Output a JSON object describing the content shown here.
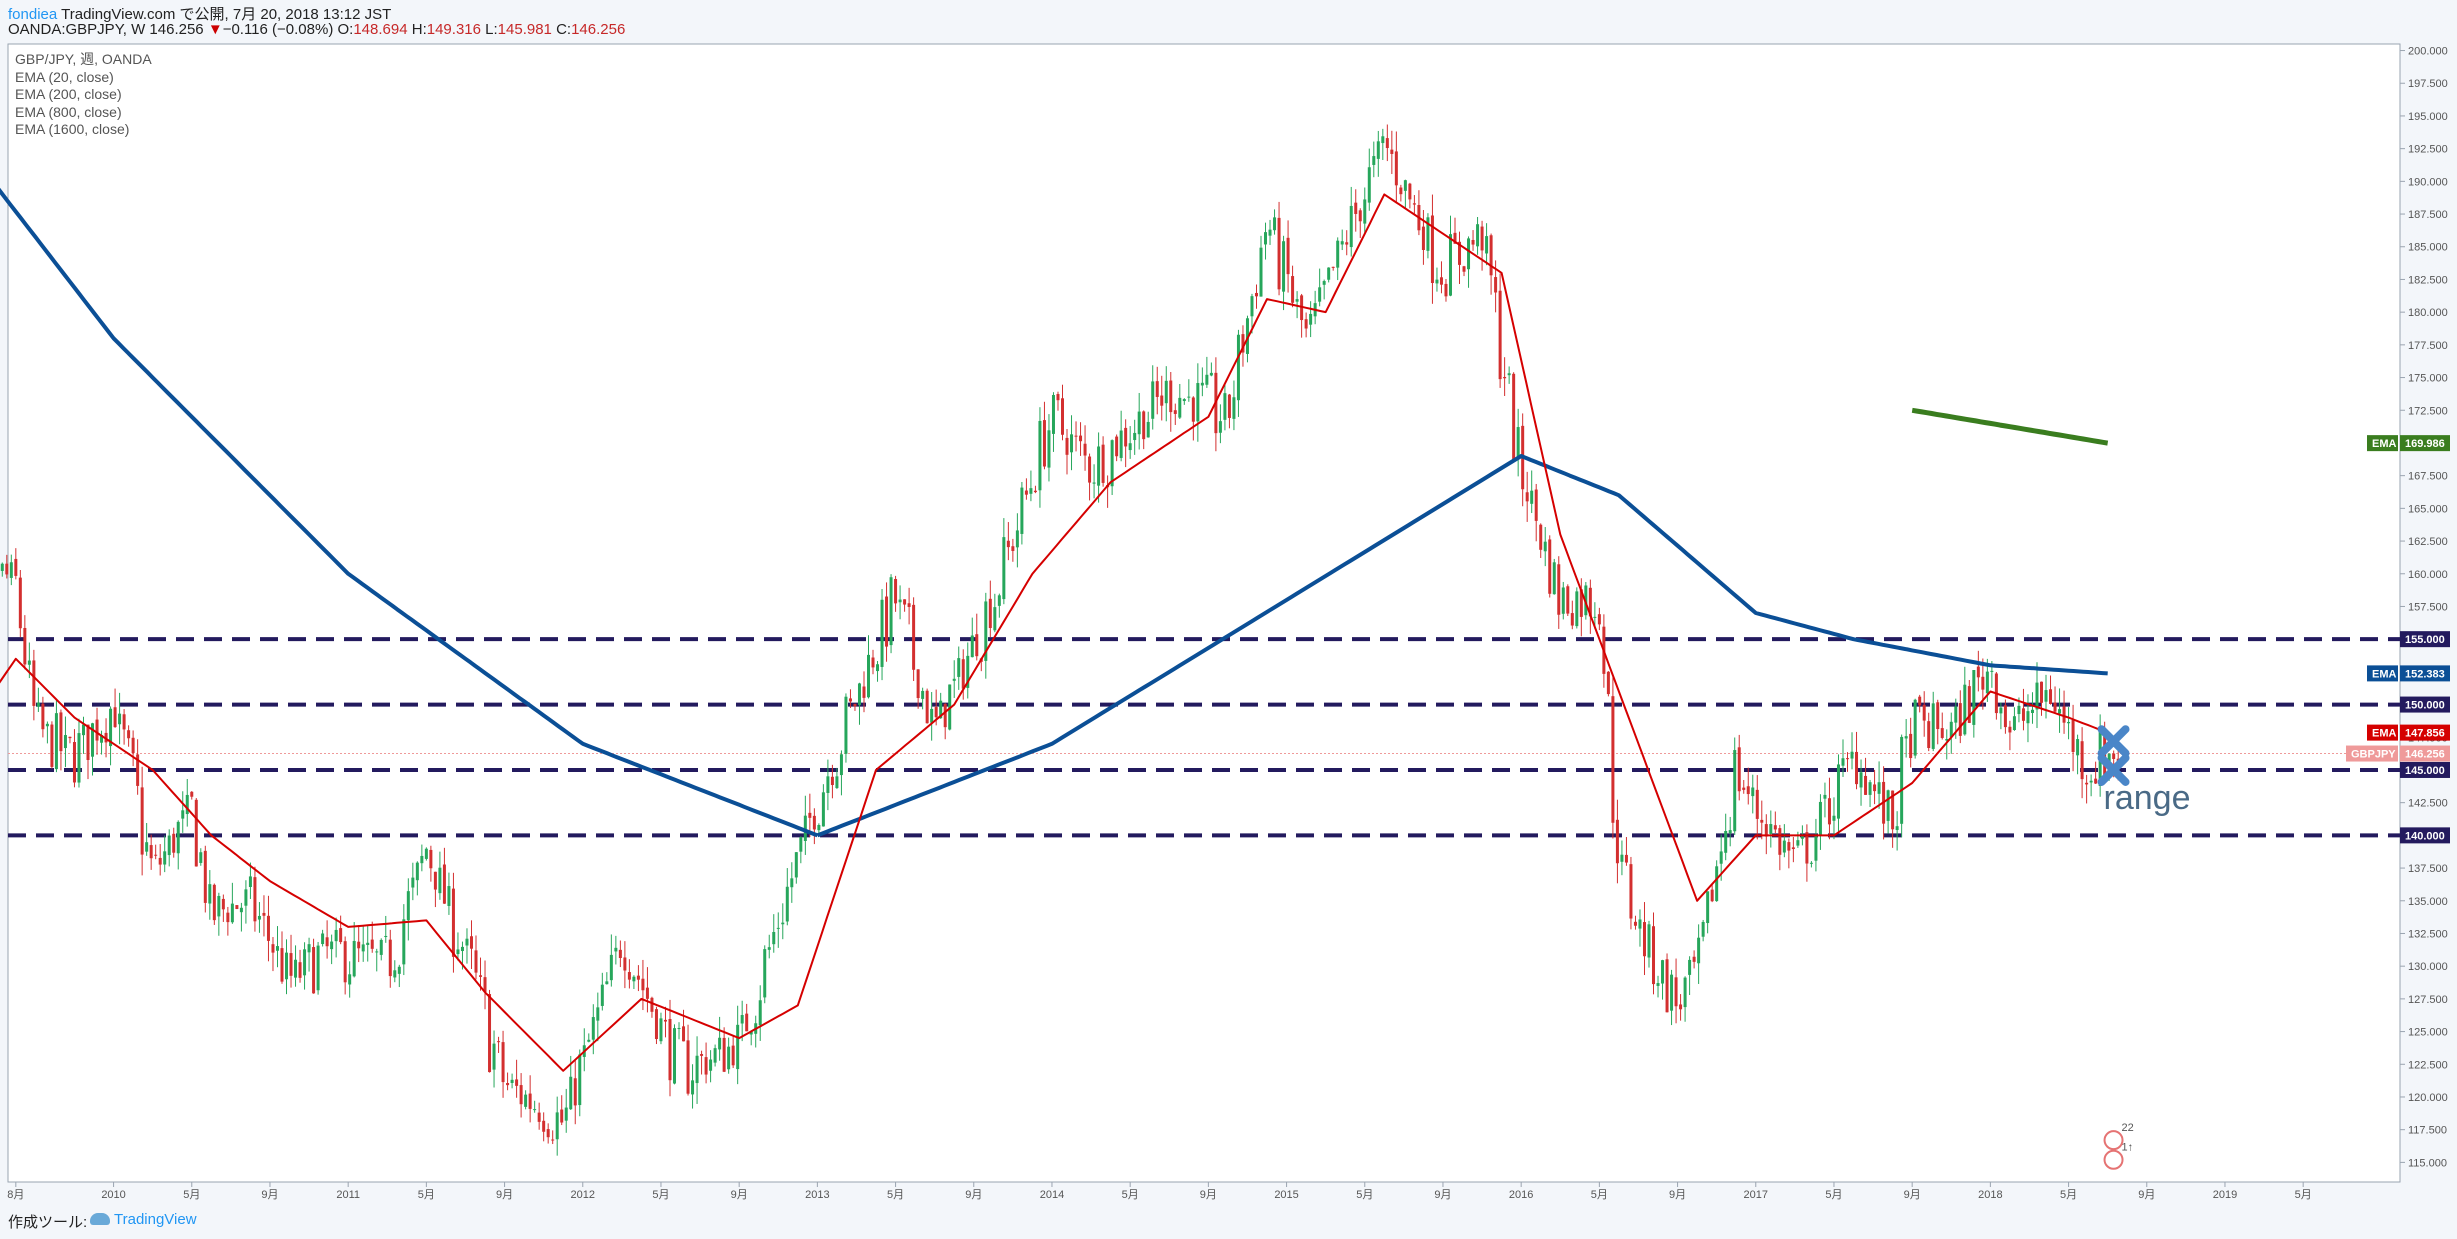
{
  "header": {
    "author": "fondiea",
    "published": "TradingView.com で公開, 7月 20, 2018 13:12 JST",
    "symbol_line": "OANDA:GBPJPY, W 146.256",
    "change_arrow": "▼",
    "change": "−0.116 (−0.08%)",
    "o_label": "O:",
    "o_value": "148.694",
    "h_label": "H:",
    "h_value": "149.316",
    "l_label": "L:",
    "l_value": "145.981",
    "c_label": "C:",
    "c_value": "146.256"
  },
  "legend": {
    "instrument": "GBP/JPY, 週, OANDA",
    "ema20": "EMA (20, close)",
    "ema200": "EMA (200, close)",
    "ema800": "EMA (800, close)",
    "ema1600": "EMA (1600, close)"
  },
  "footer": {
    "label": "作成ツール:",
    "logo_text": "TradingView"
  },
  "colors": {
    "up": "#26a65b",
    "down": "#d32f2f",
    "ema20": "#d50000",
    "ema200": "#0b4f96",
    "ema800": "#3a7d1f",
    "level": "#231a5e",
    "last_price": "#ef9a9a"
  },
  "chart_data": {
    "type": "candlestick",
    "ylim": [
      113.5,
      200.5
    ],
    "yticks": [
      "115.000",
      "117.500",
      "120.000",
      "122.500",
      "125.000",
      "127.500",
      "130.000",
      "132.500",
      "135.000",
      "137.500",
      "140.000",
      "142.500",
      "145.000",
      "147.500",
      "150.000",
      "152.500",
      "155.000",
      "157.500",
      "160.000",
      "162.500",
      "165.000",
      "167.500",
      "170.000",
      "172.500",
      "175.000",
      "177.500",
      "180.000",
      "182.500",
      "185.000",
      "187.500",
      "190.000",
      "192.500",
      "195.000",
      "197.500",
      "200.000"
    ],
    "xticks": [
      "8月",
      "2010",
      "5月",
      "9月",
      "2011",
      "5月",
      "9月",
      "2012",
      "5月",
      "9月",
      "2013",
      "5月",
      "9月",
      "2014",
      "5月",
      "9月",
      "2015",
      "5月",
      "9月",
      "2016",
      "5月",
      "9月",
      "2017",
      "5月",
      "9月",
      "2018",
      "5月",
      "9月",
      "2019",
      "5月"
    ],
    "anchors": [
      [
        "2009-05",
        150
      ],
      [
        "2009-06",
        162
      ],
      [
        "2009-08",
        159
      ],
      [
        "2009-09",
        148
      ],
      [
        "2009-11",
        146
      ],
      [
        "2010-01",
        150
      ],
      [
        "2010-03",
        137
      ],
      [
        "2010-05",
        142
      ],
      [
        "2010-06",
        134
      ],
      [
        "2010-08",
        135
      ],
      [
        "2010-10",
        129
      ],
      [
        "2010-12",
        131
      ],
      [
        "2011-03",
        130
      ],
      [
        "2011-05",
        139
      ],
      [
        "2011-07",
        131
      ],
      [
        "2011-09",
        121
      ],
      [
        "2011-12",
        118
      ],
      [
        "2012-03",
        132
      ],
      [
        "2012-06",
        122
      ],
      [
        "2012-09",
        124
      ],
      [
        "2013-01",
        143
      ],
      [
        "2013-05",
        158
      ],
      [
        "2013-07",
        148
      ],
      [
        "2013-10",
        158
      ],
      [
        "2014-01",
        172
      ],
      [
        "2014-03",
        168
      ],
      [
        "2014-07",
        174
      ],
      [
        "2014-10",
        172
      ],
      [
        "2014-12",
        187
      ],
      [
        "2015-02",
        178
      ],
      [
        "2015-06",
        193
      ],
      [
        "2015-09",
        183
      ],
      [
        "2015-11",
        186
      ],
      [
        "2016-01",
        168
      ],
      [
        "2016-03",
        158
      ],
      [
        "2016-05",
        158
      ],
      [
        "2016-06",
        138
      ],
      [
        "2016-07",
        133
      ],
      [
        "2016-09",
        127
      ],
      [
        "2016-10",
        130
      ],
      [
        "2016-12",
        145
      ],
      [
        "2017-01",
        142
      ],
      [
        "2017-03",
        138
      ],
      [
        "2017-04",
        140
      ],
      [
        "2017-06",
        146
      ],
      [
        "2017-08",
        141
      ],
      [
        "2017-09",
        148
      ],
      [
        "2017-11",
        148
      ],
      [
        "2018-01",
        153
      ],
      [
        "2018-02",
        148
      ],
      [
        "2018-04",
        151
      ],
      [
        "2018-06",
        145
      ],
      [
        "2018-07",
        146.256
      ]
    ],
    "ema20": [
      [
        "2009-05",
        147
      ],
      [
        "2009-08",
        153.5
      ],
      [
        "2009-11",
        149
      ],
      [
        "2010-03",
        145
      ],
      [
        "2010-06",
        140
      ],
      [
        "2010-09",
        136.5
      ],
      [
        "2011-01",
        133
      ],
      [
        "2011-05",
        133.5
      ],
      [
        "2011-08",
        128
      ],
      [
        "2011-12",
        122
      ],
      [
        "2012-04",
        127.5
      ],
      [
        "2012-09",
        124.5
      ],
      [
        "2012-12",
        127
      ],
      [
        "2013-04",
        145
      ],
      [
        "2013-08",
        150
      ],
      [
        "2013-12",
        160
      ],
      [
        "2014-04",
        167
      ],
      [
        "2014-09",
        172
      ],
      [
        "2014-12",
        181
      ],
      [
        "2015-03",
        180
      ],
      [
        "2015-06",
        189
      ],
      [
        "2015-09",
        186
      ],
      [
        "2015-12",
        183
      ],
      [
        "2016-03",
        163
      ],
      [
        "2016-06",
        151
      ],
      [
        "2016-10",
        135
      ],
      [
        "2017-01",
        140
      ],
      [
        "2017-05",
        140
      ],
      [
        "2017-09",
        144
      ],
      [
        "2018-01",
        151
      ],
      [
        "2018-05",
        149
      ],
      [
        "2018-07",
        147.856
      ]
    ],
    "ema200": [
      [
        "2013-01",
        140
      ],
      [
        "2014-01",
        147
      ],
      [
        "2015-01",
        158
      ],
      [
        "2016-01",
        169
      ],
      [
        "2016-06",
        166
      ],
      [
        "2017-01",
        157
      ],
      [
        "2017-06",
        155
      ],
      [
        "2018-01",
        153
      ],
      [
        "2018-07",
        152.383
      ]
    ],
    "ema200_early": [
      [
        "2009-05",
        193.5
      ],
      [
        "2010-01",
        178
      ],
      [
        "2011-01",
        160
      ],
      [
        "2012-01",
        147
      ],
      [
        "2013-01",
        140
      ]
    ],
    "ema800": [
      [
        "2017-09",
        172.5
      ],
      [
        "2018-07",
        169.986
      ]
    ],
    "levels": [
      155,
      150,
      145,
      140
    ],
    "last_price": 146.256,
    "price_tags": [
      {
        "label": "EMA",
        "value": "169.986",
        "color": "#3a7d1f"
      },
      {
        "label": "155.000",
        "value": null,
        "color": "#231a5e"
      },
      {
        "label": "EMA",
        "value": "152.383",
        "color": "#0b4f96"
      },
      {
        "label": "150.000",
        "value": null,
        "color": "#231a5e"
      },
      {
        "label": "EMA",
        "value": "147.856",
        "color": "#d50000"
      },
      {
        "label": "GBPJPY",
        "value": "146.256",
        "color": "#ef9a9a"
      },
      {
        "label": "145.000",
        "value": null,
        "color": "#231a5e"
      },
      {
        "label": "140.000",
        "value": null,
        "color": "#231a5e"
      }
    ],
    "annotations": {
      "range_text": "range",
      "event_small_1": "22",
      "event_small_2": "1↑"
    }
  }
}
